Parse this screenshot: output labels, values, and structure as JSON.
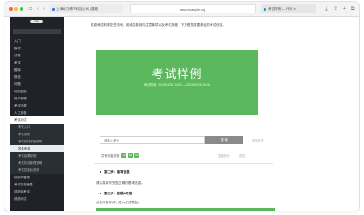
{
  "browser": {
    "tab1_title": "上海峰力教学科技公司 | 课程",
    "address": "www.example.org",
    "tab3_title": "考试样例 — 代码 ✕"
  },
  "sidebar": {
    "logo": "logo",
    "items": [
      {
        "label": "入门"
      },
      {
        "label": "模块"
      },
      {
        "label": "试卷"
      },
      {
        "label": "考试"
      },
      {
        "label": "题库"
      },
      {
        "label": "报告"
      },
      {
        "label": "问题"
      },
      {
        "label": "动态数据"
      },
      {
        "label": "用户管理"
      },
      {
        "label": "考试资源"
      },
      {
        "label": "人工判卷"
      }
    ],
    "active_group": "考试考试",
    "sub_items": [
      {
        "label": "考试入口"
      },
      {
        "label": "考试说明"
      },
      {
        "label": "考试安排详细说明"
      },
      {
        "label": "答卷信息"
      },
      {
        "label": "考试结果说明"
      },
      {
        "label": "考试状态管理说明"
      },
      {
        "label": "考试控制台说明"
      }
    ],
    "items_after": [
      {
        "label": "成绩单管理"
      },
      {
        "label": "考试状态管理"
      },
      {
        "label": "成绩单考试"
      },
      {
        "label": "成绩考试"
      }
    ]
  },
  "main": {
    "intro": "答卷考试前请花些时间，阅读答卷前的注意事项以及考试流程，下方是您将要参加的考试信息。",
    "banner": {
      "title": "考试样例",
      "meta": "考试时间: 2019/01/25 14:00 — 2019/02/28 14:00"
    },
    "search": {
      "placeholder": "请输入考号",
      "button": "搜 索",
      "side_link": "参加考试"
    },
    "count_label": "共有答卷总数",
    "counts": [
      "10",
      "20",
      "30"
    ],
    "right_links": [
      "答卷统计",
      "成绩"
    ],
    "step2_title": "第二步：填写信息",
    "step2_text": "请认真填写完整正确的基本信息。",
    "step3_title": "第三步：答题&交卷",
    "step3_text": "点击开始考试，进入考试界面。"
  },
  "colors": {
    "banner": "#5cb85c",
    "sidebar": "#1f2328",
    "button": "#8a8a8a"
  }
}
